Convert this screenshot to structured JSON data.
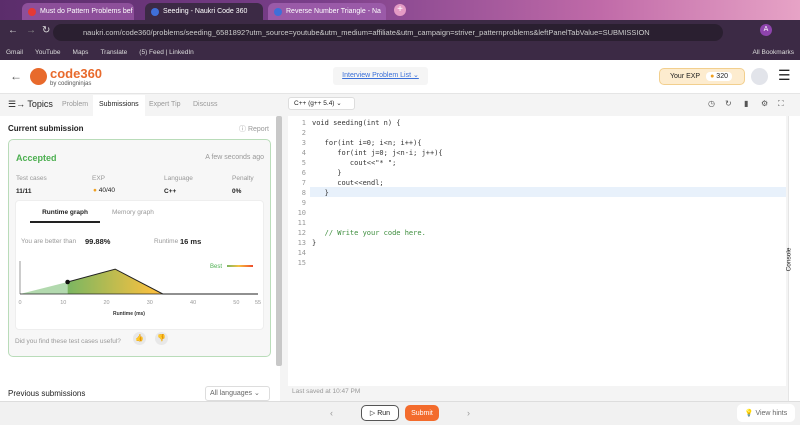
{
  "browser": {
    "tabs": [
      {
        "label": "Must do Pattern Problems bef",
        "color": "#e53935"
      },
      {
        "label": "Seeding - Naukri Code 360",
        "color": "#3f6fd8"
      },
      {
        "label": "Reverse Number Triangle - Na",
        "color": "#3f6fd8"
      }
    ],
    "url": "naukri.com/code360/problems/seeding_6581892?utm_source=youtube&utm_medium=affiliate&utm_campaign=striver_patternproblems&leftPanelTabValue=SUBMISSION",
    "bookmarks": [
      "Gmail",
      "YouTube",
      "Maps",
      "Translate",
      "(5) Feed | LinkedIn"
    ],
    "all_bookmarks": "All Bookmarks",
    "avatar": "A"
  },
  "header": {
    "logo_main": "code360",
    "logo_sub": "by codingninjas",
    "problem_list": "Interview Problem List",
    "exp_label": "Your EXP",
    "exp_value": "320"
  },
  "left_tabs": {
    "topics": "Topics",
    "items": [
      "Problem",
      "Submissions",
      "Expert Tip",
      "Discuss"
    ],
    "active": "Submissions"
  },
  "submission": {
    "title": "Current submission",
    "report": "Report",
    "status": "Accepted",
    "time": "A few seconds ago",
    "stats": [
      {
        "label": "Test cases",
        "value": "11/11"
      },
      {
        "label": "EXP",
        "value": "40/40"
      },
      {
        "label": "Language",
        "value": "C++"
      },
      {
        "label": "Penalty",
        "value": "0%"
      }
    ],
    "graph_tabs": [
      "Runtime graph",
      "Memory graph"
    ],
    "better_label": "You are better than",
    "better_value": "99.88%",
    "runtime_label": "Runtime",
    "runtime_value": "16 ms",
    "legend": "Best",
    "feedback": "Did you find these test cases useful?"
  },
  "chart_data": {
    "type": "area",
    "xlabel": "Runtime (ms)",
    "x_ticks": [
      0,
      10,
      20,
      30,
      40,
      50,
      55
    ],
    "xlim": [
      0,
      55
    ],
    "x": [
      0,
      11,
      22,
      33,
      55
    ],
    "y": [
      0,
      0.4,
      0.83,
      0,
      0
    ],
    "marker": {
      "x": 11,
      "y": 0.4
    },
    "legend": "Best",
    "legend_placement": "top-right"
  },
  "previous": {
    "title": "Previous submissions",
    "filter": "All languages"
  },
  "editor": {
    "language": "C++ (g++ 5.4)",
    "lines": [
      "void seeding(int n) {",
      "",
      "   for(int i=0; i<n; i++){",
      "      for(int j=0; j<n-i; j++){",
      "         cout<<\"* \";",
      "      }",
      "      cout<<endl;",
      "   }",
      "",
      "",
      "",
      "   // Write your code here.",
      "}",
      "",
      ""
    ],
    "last_saved": "Last saved at 10:47 PM",
    "console": "Console"
  },
  "footer": {
    "run": "Run",
    "submit": "Submit",
    "hints": "View hints"
  }
}
